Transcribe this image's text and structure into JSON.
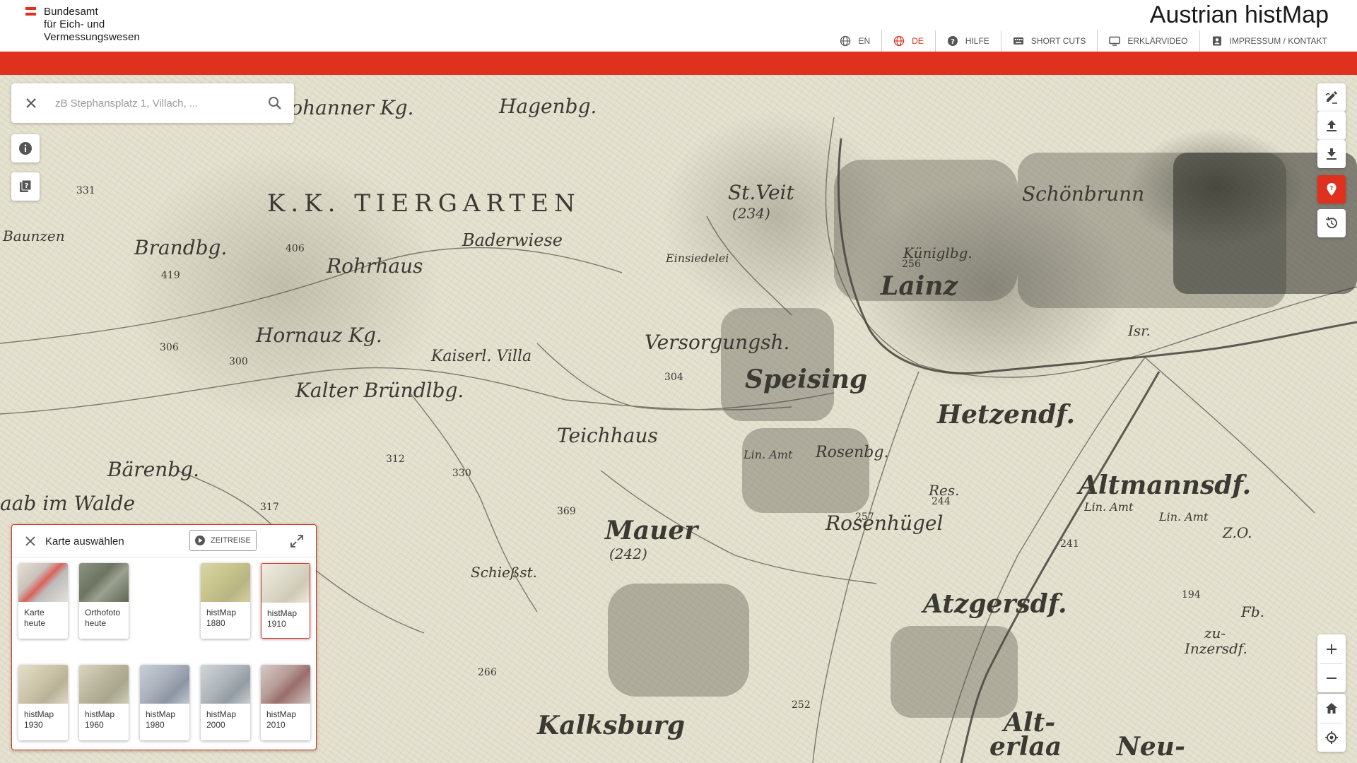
{
  "header": {
    "logo_lines": [
      "Bundesamt",
      "für Eich- und",
      "Vermessungswesen"
    ],
    "title": "Austrian histMap",
    "flag_colors": [
      "#e0301e",
      "#ffffff",
      "#e0301e"
    ],
    "nav": [
      {
        "label": "EN",
        "icon": "globe-icon",
        "active": false
      },
      {
        "label": "DE",
        "icon": "globe-icon",
        "active": true
      },
      {
        "label": "HILFE",
        "icon": "help-icon",
        "active": false
      },
      {
        "label": "SHORT CUTS",
        "icon": "keyboard-icon",
        "active": false
      },
      {
        "label": "ERKLÄRVIDEO",
        "icon": "monitor-icon",
        "active": false
      },
      {
        "label": "IMPRESSUM / KONTAKT",
        "icon": "contact-icon",
        "active": false
      }
    ]
  },
  "colors": {
    "accent": "#e0301e",
    "map_paper": "#e6e2d0"
  },
  "search": {
    "placeholder": "zB Stephansplatz 1, Villach, ..."
  },
  "left_tools": [
    {
      "icon": "info-icon"
    },
    {
      "icon": "legend-book-icon"
    }
  ],
  "right_tools": [
    {
      "icon": "draw-edit-icon"
    },
    {
      "icon": "upload-icon"
    },
    {
      "icon": "download-icon"
    },
    {
      "icon": "location-pin-icon",
      "active": true
    },
    {
      "icon": "history-icon"
    }
  ],
  "map_labels": [
    "Johanner Kg.",
    "Hagenbg.",
    "K.K. TIERGARTEN",
    "Baderwiese",
    "Rohrhaus",
    "St.Veit",
    "(234)",
    "Einsiedelei",
    "Schönbrunn",
    "Küniglbg.",
    "Lainz",
    "Brandbg.",
    "Baunzen",
    "Hornauz Kg.",
    "Kaiserl. Villa",
    "Versorgungsh.",
    "Speising",
    "Kalter Bründlbg.",
    "Hetzendf.",
    "Teichhaus",
    "Lin. Amt",
    "Rosenbg.",
    "Res.",
    "Altmannsdf.",
    "Bärenbg.",
    "aab im Walde",
    "Mauer",
    "(242)",
    "Rosenhügel",
    "Schießst.",
    "Atzgersdf.",
    "zu-",
    "Inzersdf.",
    "Kalksburg",
    "Alt-",
    "erlaa",
    "Neu-",
    "Fb.",
    "Lin. Amt",
    "Lin. Amt",
    "Z.O.",
    "406",
    "419",
    "331",
    "306",
    "300",
    "312",
    "330",
    "317",
    "369",
    "304",
    "256",
    "244",
    "257",
    "194",
    "266",
    "252",
    "241",
    "Isr."
  ],
  "panel": {
    "title": "Karte auswählen",
    "zeitreise_label": "ZEITREISE",
    "maps_row1": [
      {
        "label1": "Karte",
        "label2": "heute",
        "selected": false
      },
      {
        "label1": "Orthofoto",
        "label2": "heute",
        "selected": false
      },
      {
        "label1": "histMap",
        "label2": "1880",
        "selected": false
      },
      {
        "label1": "histMap",
        "label2": "1910",
        "selected": true
      }
    ],
    "maps_row2": [
      {
        "label1": "histMap",
        "label2": "1930",
        "selected": false
      },
      {
        "label1": "histMap",
        "label2": "1960",
        "selected": false
      },
      {
        "label1": "histMap",
        "label2": "1980",
        "selected": false
      },
      {
        "label1": "histMap",
        "label2": "2000",
        "selected": false
      },
      {
        "label1": "histMap",
        "label2": "2010",
        "selected": false
      }
    ]
  },
  "zoom": {
    "in": "+",
    "out": "−"
  }
}
